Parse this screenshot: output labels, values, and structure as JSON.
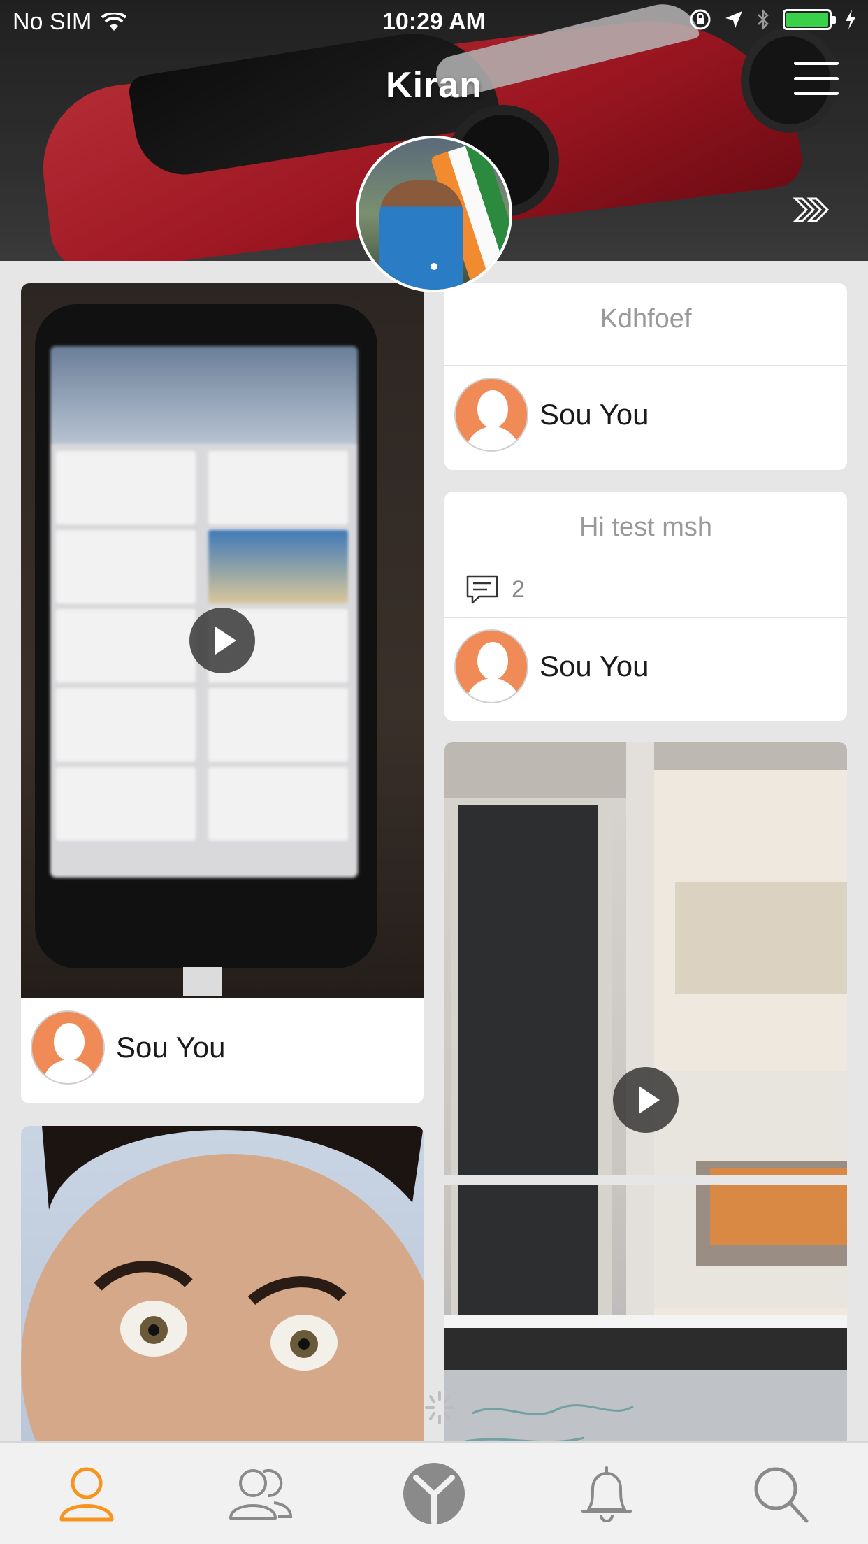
{
  "status_bar": {
    "carrier": "No SIM",
    "time": "10:29 AM",
    "battery_color": "#3ad14a"
  },
  "header": {
    "title": "Kiran",
    "menu_icon": "hamburger-menu-icon",
    "forward_icon": "double-chevron-right-icon"
  },
  "feed": {
    "left_column": [
      {
        "type": "video",
        "author": "Sou You"
      },
      {
        "type": "photo"
      }
    ],
    "right_column": [
      {
        "type": "text",
        "title": "Kdhfoef",
        "author": "Sou You"
      },
      {
        "type": "text",
        "title": "Hi test msh",
        "comment_count": "2",
        "author": "Sou You"
      },
      {
        "type": "video"
      }
    ]
  },
  "tabbar": {
    "items": [
      {
        "icon": "profile-icon",
        "active": true
      },
      {
        "icon": "friends-icon",
        "active": false
      },
      {
        "icon": "app-logo-icon",
        "active": false
      },
      {
        "icon": "bell-icon",
        "active": false
      },
      {
        "icon": "search-icon",
        "active": false
      }
    ],
    "active_color": "#f7941d",
    "inactive_color": "#8a8a8a"
  }
}
